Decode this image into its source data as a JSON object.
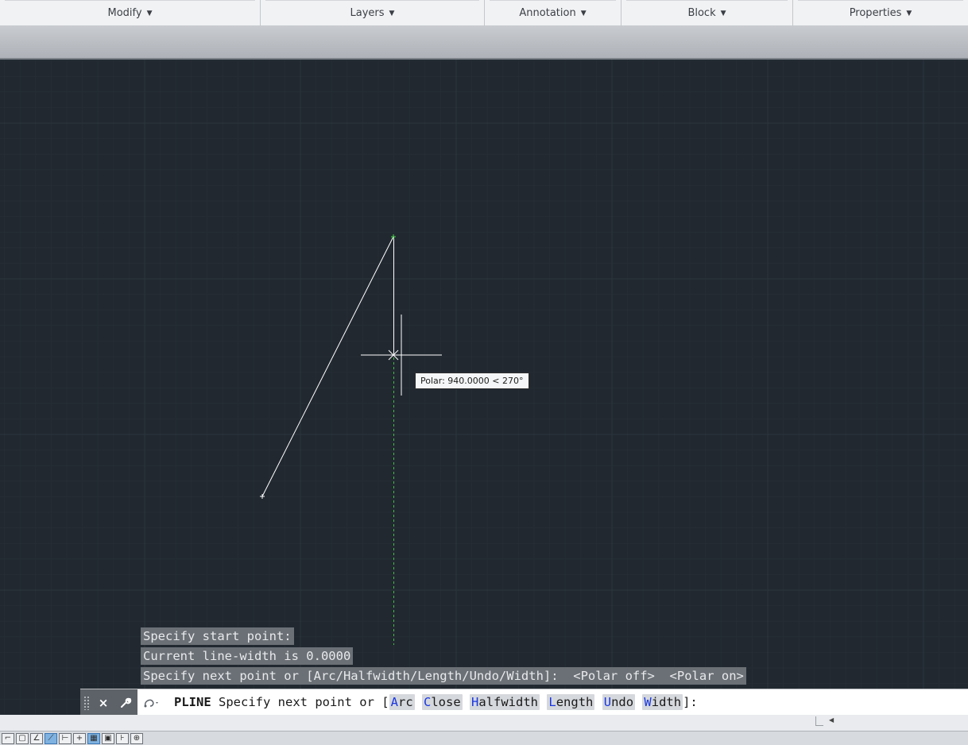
{
  "ribbon": {
    "panels": [
      {
        "label": "Modify",
        "caret": "▼"
      },
      {
        "label": "Layers",
        "caret": "▼"
      },
      {
        "label": "Annotation",
        "caret": "▼"
      },
      {
        "label": "Block",
        "caret": "▼"
      },
      {
        "label": "Properties",
        "caret": "▼"
      }
    ]
  },
  "canvas": {
    "background": "#212830",
    "tooltip": "Polar: 940.0000 < 270°"
  },
  "command_history": [
    "Specify start point:",
    "Current line-width is 0.0000",
    "Specify next point or [Arc/Halfwidth/Length/Undo/Width]:  <Polar off>  <Polar on>"
  ],
  "command_line": {
    "close_icon": "×",
    "command": "PLINE",
    "prompt": " Specify next point or [",
    "options": [
      {
        "key": "A",
        "rest": "rc"
      },
      {
        "key": "C",
        "rest": "lose"
      },
      {
        "key": "H",
        "rest": "alfwidth"
      },
      {
        "key": "L",
        "rest": "ength"
      },
      {
        "key": "U",
        "rest": "ndo"
      },
      {
        "key": "W",
        "rest": "idth"
      }
    ],
    "suffix": "]:"
  },
  "status_bar": {
    "buttons": [
      {
        "icon": "grid-icon",
        "glyph": "⌐",
        "on": false
      },
      {
        "icon": "snap-icon",
        "glyph": "▢",
        "on": false
      },
      {
        "icon": "ortho-icon",
        "glyph": "∠",
        "on": false
      },
      {
        "icon": "polar-icon",
        "glyph": "⟋",
        "on": true
      },
      {
        "icon": "osnap-icon",
        "glyph": "⊢",
        "on": false
      },
      {
        "icon": "otrack-icon",
        "glyph": "+",
        "on": false
      },
      {
        "icon": "lineweight-icon",
        "glyph": "▦",
        "on": true
      },
      {
        "icon": "transparency-icon",
        "glyph": "▣",
        "on": false
      },
      {
        "icon": "selection-cycling-icon",
        "glyph": "⊦",
        "on": false
      },
      {
        "icon": "ucs-icon",
        "glyph": "⊕",
        "on": false
      }
    ]
  }
}
